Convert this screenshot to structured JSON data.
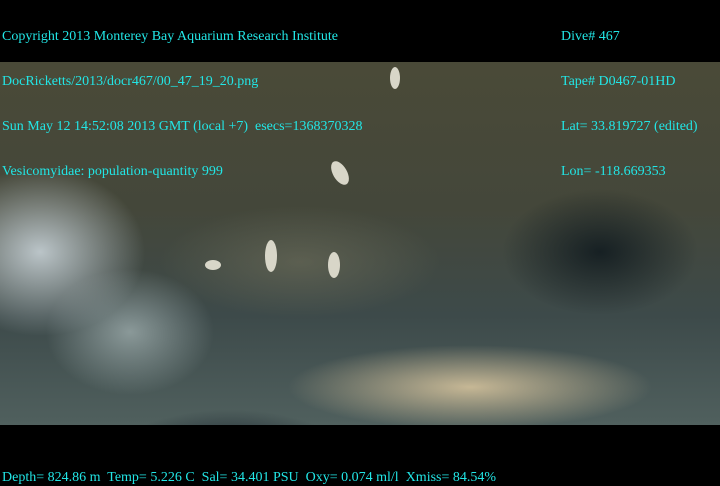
{
  "overlay_left": [
    "Copyright 2013 Monterey Bay Aquarium Research Institute",
    "DocRicketts/2013/docr467/00_47_19_20.png",
    "Sun May 12 14:52:08 2013 GMT (local +7)  esecs=1368370328",
    "Vesicomyidae: population-quantity 999"
  ],
  "overlay_right": [
    "Dive# 467",
    "Tape# D0467-01HD",
    "Lat= 33.819727 (edited)",
    "Lon= -118.669353"
  ],
  "overlay_bottom": "Depth= 824.86 m  Temp= 5.226 C  Sal= 34.401 PSU  Oxy= 0.074 ml/l  Xmiss= 84.54%",
  "colors": {
    "overlay_text": "#22e6e6"
  }
}
